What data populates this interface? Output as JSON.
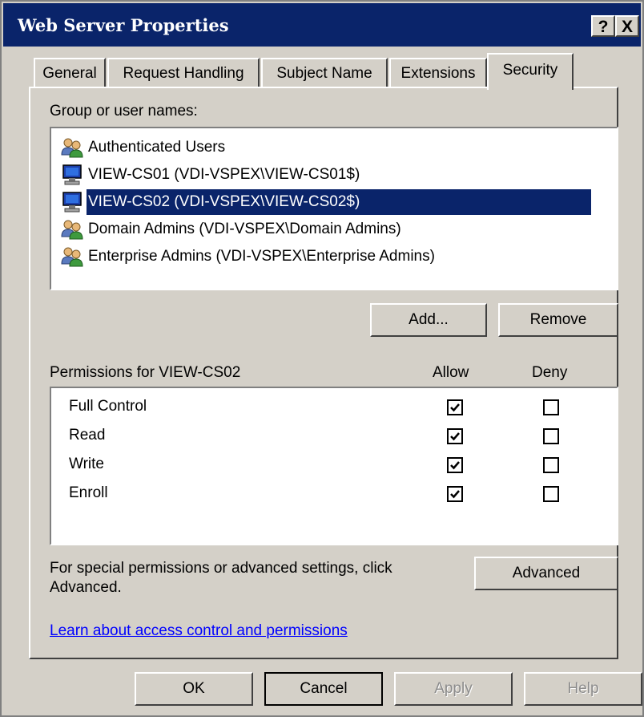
{
  "window": {
    "title": "Web Server Properties",
    "help_button": "?",
    "close_button": "X"
  },
  "tabs": [
    {
      "label": "General",
      "active": false
    },
    {
      "label": "Request Handling",
      "active": false
    },
    {
      "label": "Subject Name",
      "active": false
    },
    {
      "label": "Extensions",
      "active": false
    },
    {
      "label": "Security",
      "active": true
    }
  ],
  "users": {
    "label": "Group or user names:",
    "items": [
      {
        "name": "Authenticated Users",
        "icon": "group-icon",
        "selected": false
      },
      {
        "name": "VIEW-CS01 (VDI-VSPEX\\VIEW-CS01$)",
        "icon": "computer-icon",
        "selected": false
      },
      {
        "name": "VIEW-CS02 (VDI-VSPEX\\VIEW-CS02$)",
        "icon": "computer-icon",
        "selected": true
      },
      {
        "name": "Domain Admins (VDI-VSPEX\\Domain Admins)",
        "icon": "group-icon",
        "selected": false
      },
      {
        "name": "Enterprise Admins (VDI-VSPEX\\Enterprise Admins)",
        "icon": "group-icon",
        "selected": false
      }
    ],
    "add_button": "Add...",
    "remove_button": "Remove"
  },
  "permissions": {
    "title": "Permissions for VIEW-CS02",
    "allow_header": "Allow",
    "deny_header": "Deny",
    "rows": [
      {
        "name": "Full Control",
        "allow": true,
        "deny": false
      },
      {
        "name": "Read",
        "allow": true,
        "deny": false
      },
      {
        "name": "Write",
        "allow": true,
        "deny": false
      },
      {
        "name": "Enroll",
        "allow": true,
        "deny": false
      }
    ]
  },
  "advanced": {
    "text_line1": "For special permissions or advanced settings, click",
    "text_line2": "Advanced.",
    "button": "Advanced"
  },
  "link": "Learn about access control and permissions",
  "footer": {
    "ok": "OK",
    "cancel": "Cancel",
    "apply": "Apply",
    "help": "Help"
  },
  "colors": {
    "title_bar": "#0a246a",
    "dialog_face": "#d4d0c8",
    "selection": "#0a246a",
    "link": "#0000ff"
  }
}
